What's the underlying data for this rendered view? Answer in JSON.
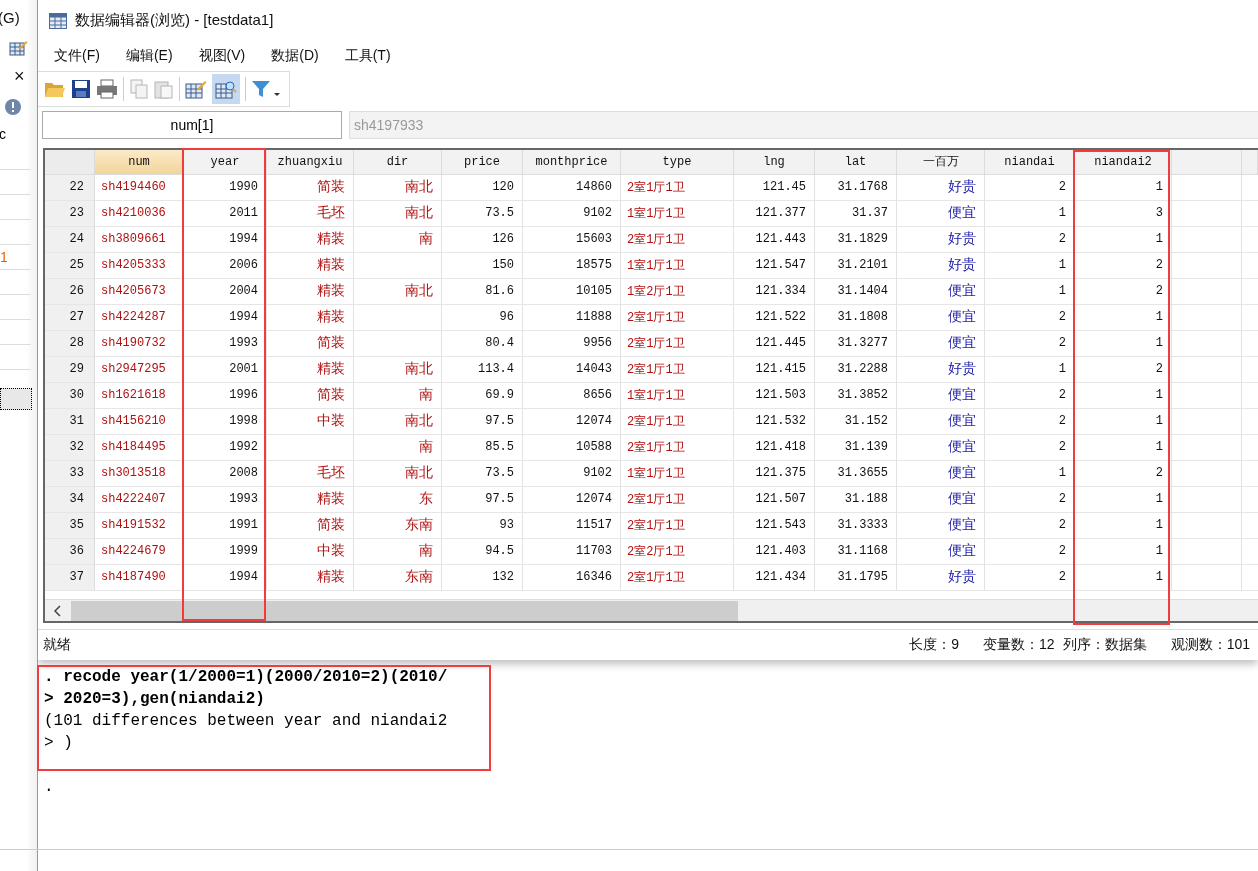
{
  "left_panel": {
    "menu_fragment": "(G)",
    "close_glyph": "×",
    "label_fragment": "c",
    "value_fragment": "1"
  },
  "window": {
    "title": "数据编辑器(浏览) - [testdata1]"
  },
  "menu": [
    "文件(F)",
    "编辑(E)",
    "视图(V)",
    "数据(D)",
    "工具(T)"
  ],
  "toolbar": {
    "browse_selected": true
  },
  "varname_field": {
    "value": "num[1]"
  },
  "value_field": {
    "value": "sh4197933"
  },
  "table": {
    "columns": [
      {
        "label": "num",
        "kind": "string",
        "selected": true
      },
      {
        "label": "year",
        "kind": "number",
        "selected": false
      },
      {
        "label": "zhuangxiu",
        "kind": "string",
        "selected": false
      },
      {
        "label": "dir",
        "kind": "string",
        "selected": false
      },
      {
        "label": "price",
        "kind": "number",
        "selected": false
      },
      {
        "label": "monthprice",
        "kind": "number",
        "selected": false
      },
      {
        "label": "type",
        "kind": "string",
        "selected": false
      },
      {
        "label": "lng",
        "kind": "number",
        "selected": false
      },
      {
        "label": "lat",
        "kind": "number",
        "selected": false
      },
      {
        "label": "一百万",
        "kind": "labeled",
        "selected": false
      },
      {
        "label": "niandai",
        "kind": "number",
        "selected": false
      },
      {
        "label": "niandai2",
        "kind": "number",
        "selected": false
      }
    ],
    "rows": [
      {
        "index": "22",
        "cells": [
          "sh4194460",
          "1990",
          "简装",
          "南北",
          "120",
          "14860",
          "2室1厅1卫",
          "121.45",
          "31.1768",
          "好贵",
          "2",
          "1"
        ]
      },
      {
        "index": "23",
        "cells": [
          "sh4210036",
          "2011",
          "毛坯",
          "南北",
          "73.5",
          "9102",
          "1室1厅1卫",
          "121.377",
          "31.37",
          "便宜",
          "1",
          "3"
        ]
      },
      {
        "index": "24",
        "cells": [
          "sh3809661",
          "1994",
          "精装",
          "南",
          "126",
          "15603",
          "2室1厅1卫",
          "121.443",
          "31.1829",
          "好贵",
          "2",
          "1"
        ]
      },
      {
        "index": "25",
        "cells": [
          "sh4205333",
          "2006",
          "精装",
          null,
          "150",
          "18575",
          "1室1厅1卫",
          "121.547",
          "31.2101",
          "好贵",
          "1",
          "2"
        ]
      },
      {
        "index": "26",
        "cells": [
          "sh4205673",
          "2004",
          "精装",
          "南北",
          "81.6",
          "10105",
          "1室2厅1卫",
          "121.334",
          "31.1404",
          "便宜",
          "1",
          "2"
        ]
      },
      {
        "index": "27",
        "cells": [
          "sh4224287",
          "1994",
          "精装",
          null,
          "96",
          "11888",
          "2室1厅1卫",
          "121.522",
          "31.1808",
          "便宜",
          "2",
          "1"
        ]
      },
      {
        "index": "28",
        "cells": [
          "sh4190732",
          "1993",
          "简装",
          null,
          "80.4",
          "9956",
          "2室1厅1卫",
          "121.445",
          "31.3277",
          "便宜",
          "2",
          "1"
        ]
      },
      {
        "index": "29",
        "cells": [
          "sh2947295",
          "2001",
          "精装",
          "南北",
          "113.4",
          "14043",
          "2室1厅1卫",
          "121.415",
          "31.2288",
          "好贵",
          "1",
          "2"
        ]
      },
      {
        "index": "30",
        "cells": [
          "sh1621618",
          "1996",
          "简装",
          "南",
          "69.9",
          "8656",
          "1室1厅1卫",
          "121.503",
          "31.3852",
          "便宜",
          "2",
          "1"
        ]
      },
      {
        "index": "31",
        "cells": [
          "sh4156210",
          "1998",
          "中装",
          "南北",
          "97.5",
          "12074",
          "2室1厅1卫",
          "121.532",
          "31.152",
          "便宜",
          "2",
          "1"
        ]
      },
      {
        "index": "32",
        "cells": [
          "sh4184495",
          "1992",
          null,
          "南",
          "85.5",
          "10588",
          "2室1厅1卫",
          "121.418",
          "31.139",
          "便宜",
          "2",
          "1"
        ]
      },
      {
        "index": "33",
        "cells": [
          "sh3013518",
          "2008",
          "毛坯",
          "南北",
          "73.5",
          "9102",
          "1室1厅1卫",
          "121.375",
          "31.3655",
          "便宜",
          "1",
          "2"
        ]
      },
      {
        "index": "34",
        "cells": [
          "sh4222407",
          "1993",
          "精装",
          "东",
          "97.5",
          "12074",
          "2室1厅1卫",
          "121.507",
          "31.188",
          "便宜",
          "2",
          "1"
        ]
      },
      {
        "index": "35",
        "cells": [
          "sh4191532",
          "1991",
          "简装",
          "东南",
          "93",
          "11517",
          "2室1厅1卫",
          "121.543",
          "31.3333",
          "便宜",
          "2",
          "1"
        ]
      },
      {
        "index": "36",
        "cells": [
          "sh4224679",
          "1999",
          "中装",
          "南",
          "94.5",
          "11703",
          "2室2厅1卫",
          "121.403",
          "31.1168",
          "便宜",
          "2",
          "1"
        ]
      },
      {
        "index": "37",
        "cells": [
          "sh4187490",
          "1994",
          "精装",
          "东南",
          "132",
          "16346",
          "2室1厅1卫",
          "121.434",
          "31.1795",
          "好贵",
          "2",
          "1"
        ]
      }
    ]
  },
  "status_bar": {
    "state": "就绪",
    "length": "长度：9",
    "variables": "变量数：12",
    "order": "列序：数据集",
    "observations": "观测数：101"
  },
  "console": [
    {
      "kind": "command",
      "text": ". recode year(1/2000=1)(2000/2010=2)(2010/"
    },
    {
      "kind": "command",
      "text": "> 2020=3),gen(niandai2)"
    },
    {
      "kind": "output",
      "text": "(101 differences between year and niandai2"
    },
    {
      "kind": "output",
      "text": "> )"
    },
    {
      "kind": "prompt",
      "text": "."
    }
  ]
}
